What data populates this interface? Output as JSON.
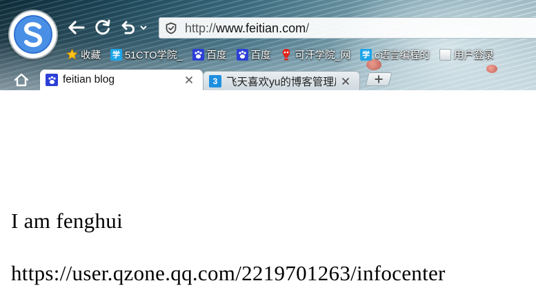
{
  "browser": {
    "address_bar": {
      "url_scheme": "http://",
      "url_domain": "www.feitian.com",
      "url_path": "/"
    },
    "bookmarks": [
      {
        "label": "收藏",
        "icon": "star-icon"
      },
      {
        "label": "51CTO学院_",
        "icon": "xue-icon"
      },
      {
        "label": "百度",
        "icon": "baidu-paw-icon"
      },
      {
        "label": "百度",
        "icon": "baidu-paw-icon"
      },
      {
        "label": "可汗学院_网",
        "icon": "khan-icon"
      },
      {
        "label": "c语言编程的",
        "icon": "xue-icon"
      },
      {
        "label": "用户登录",
        "icon": "blank-page-icon"
      }
    ],
    "tabs": [
      {
        "title": "feitian blog",
        "active": true,
        "icon": "baidu-paw-icon"
      },
      {
        "title": "飞天喜欢yu的博客管理后",
        "active": false,
        "icon": "tab-3-icon"
      }
    ],
    "colors": {
      "chrome_dark": "#1f4c5f",
      "chrome_light": "#b8d2dc",
      "logo_blue": "#3f86e0",
      "page_background": "#ffffff"
    }
  },
  "page": {
    "lines": [
      "I am fenghui",
      "https://user.qzone.qq.com/2219701263/infocenter"
    ]
  }
}
